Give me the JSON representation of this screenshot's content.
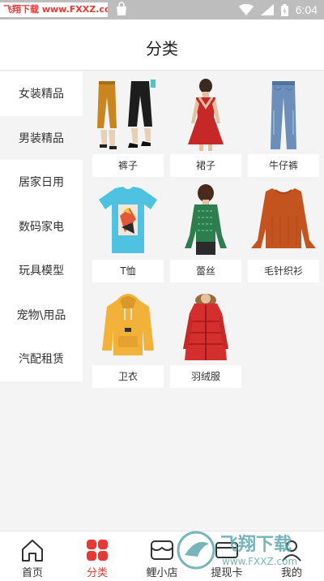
{
  "status_bar": {
    "watermark": "飞翔下载 www.FXXZ.com",
    "time": "6:04"
  },
  "header": {
    "title": "分类"
  },
  "sidebar": {
    "items": [
      {
        "label": "女装精品",
        "active": false
      },
      {
        "label": "男装精品",
        "active": true
      },
      {
        "label": "居家日用",
        "active": false
      },
      {
        "label": "数码家电",
        "active": false
      },
      {
        "label": "玩具模型",
        "active": false
      },
      {
        "label": "宠物\\用品",
        "active": false
      },
      {
        "label": "汽配租赁",
        "active": false
      }
    ]
  },
  "products": [
    {
      "label": "裤子",
      "icon": "pants-image"
    },
    {
      "label": "裙子",
      "icon": "dress-image"
    },
    {
      "label": "牛仔裤",
      "icon": "jeans-image"
    },
    {
      "label": "T恤",
      "icon": "tshirt-image"
    },
    {
      "label": "蕾丝",
      "icon": "lace-top-image"
    },
    {
      "label": "毛针织衫",
      "icon": "sweater-image"
    },
    {
      "label": "卫衣",
      "icon": "hoodie-image"
    },
    {
      "label": "羽绒服",
      "icon": "down-jacket-image"
    }
  ],
  "tabbar": {
    "tabs": [
      {
        "label": "首页",
        "active": false
      },
      {
        "label": "分类",
        "active": true
      },
      {
        "label": "鲤小店",
        "active": false
      },
      {
        "label": "提现卡",
        "active": false
      },
      {
        "label": "我的",
        "active": false
      }
    ]
  },
  "watermark_logo": {
    "text": "飞翔下载",
    "url": "www.FXXZ.com"
  },
  "colors": {
    "accent": "#e53935",
    "status_bar": "#bdbdbd",
    "background": "#f4f4f4"
  }
}
